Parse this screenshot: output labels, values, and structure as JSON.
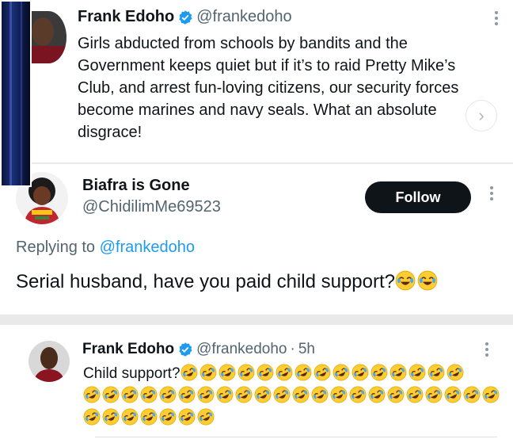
{
  "top_tweet": {
    "display_name": "Frank Edoho",
    "handle": "@frankedoho",
    "text_lines": [
      "Girls abducted from schools by bandits and the",
      "Government keeps quiet but if it’s to raid Pretty Mike’s",
      "Club, and arrest fun-loving citizens, our security forces",
      "become marines and navy seals. What an absolute",
      "disgrace!"
    ],
    "icons": {
      "verified": "verified-badge-icon",
      "more": "more-options-icon",
      "next": "chevron-right-icon"
    }
  },
  "reply_tweet": {
    "display_name": "Biafra is Gone",
    "handle": "@ChidilimMe69523",
    "follow_label": "Follow",
    "replying_prefix": "Replying to ",
    "replying_mention": "@frankedoho",
    "text": "Serial husband, have you paid child support?",
    "emoji_count": 2,
    "emoji": "face-with-tears-of-joy"
  },
  "response_tweet": {
    "display_name": "Frank Edoho",
    "handle": "@frankedoho",
    "separator": "·",
    "time": "5h",
    "text": "Child support?",
    "emoji": "rolling-on-the-floor-laughing",
    "emoji_rows": [
      15,
      22,
      7
    ]
  },
  "colors": {
    "text": "#0f1419",
    "secondary": "#536471",
    "link": "#1d9bf0",
    "button": "#0f1419"
  }
}
